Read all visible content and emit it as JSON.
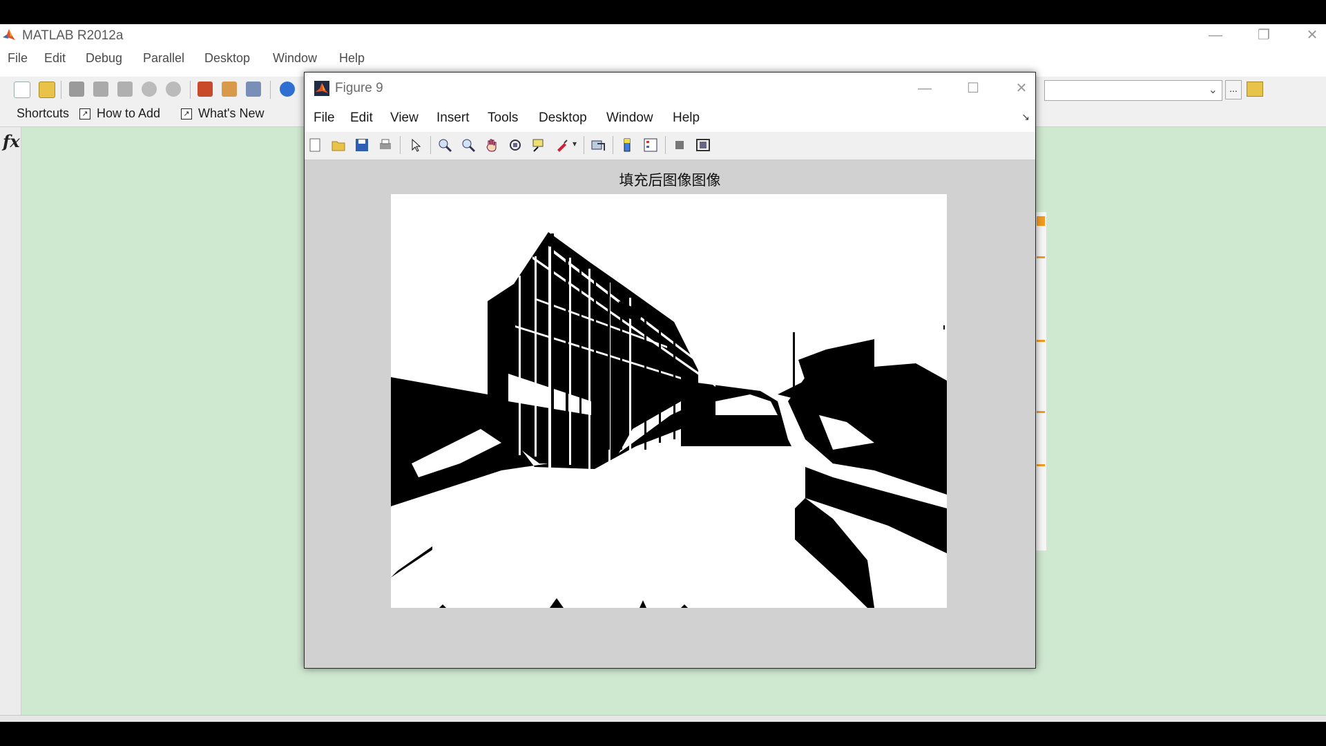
{
  "matlab": {
    "title": "MATLAB R2012a",
    "window_controls": {
      "minimize": "—",
      "restore": "❐",
      "close": "✕"
    },
    "menu": [
      "File",
      "Edit",
      "Debug",
      "Parallel",
      "Desktop",
      "Window",
      "Help"
    ],
    "shortcuts": {
      "label": "Shortcuts",
      "how_to_add": "How to Add",
      "whats_new": "What's New"
    },
    "function_hint": "fx",
    "browse_label": "..."
  },
  "figure": {
    "title": "Figure 9",
    "window_controls": {
      "minimize": "—",
      "maximize": "☐",
      "close": "✕"
    },
    "menu": [
      "File",
      "Edit",
      "View",
      "Insert",
      "Tools",
      "Desktop",
      "Window",
      "Help"
    ],
    "axes_title": "填充后图像图像",
    "image_description": "binary black-and-white image of a building facade, road and trees"
  },
  "colors": {
    "command_window_bg": "#cfe8d0",
    "figure_bg": "#d1d1d1",
    "accent_orange": "#f59b20"
  },
  "icons": {
    "matlab_toolbar": [
      "new-file-icon",
      "open-icon",
      "cut-icon",
      "copy-icon",
      "paste-icon",
      "undo-icon",
      "redo-icon",
      "simulink-icon",
      "guide-icon",
      "profiler-icon",
      "help-icon"
    ],
    "figure_toolbar": [
      "new-figure-icon",
      "open-file-icon",
      "save-icon",
      "print-icon",
      "edit-plot-icon",
      "zoom-in-icon",
      "zoom-out-icon",
      "pan-icon",
      "rotate-icon",
      "data-cursor-icon",
      "brush-icon",
      "link-icon",
      "colorbar-icon",
      "legend-icon",
      "hide-plot-tools-icon",
      "show-plot-tools-icon"
    ]
  }
}
